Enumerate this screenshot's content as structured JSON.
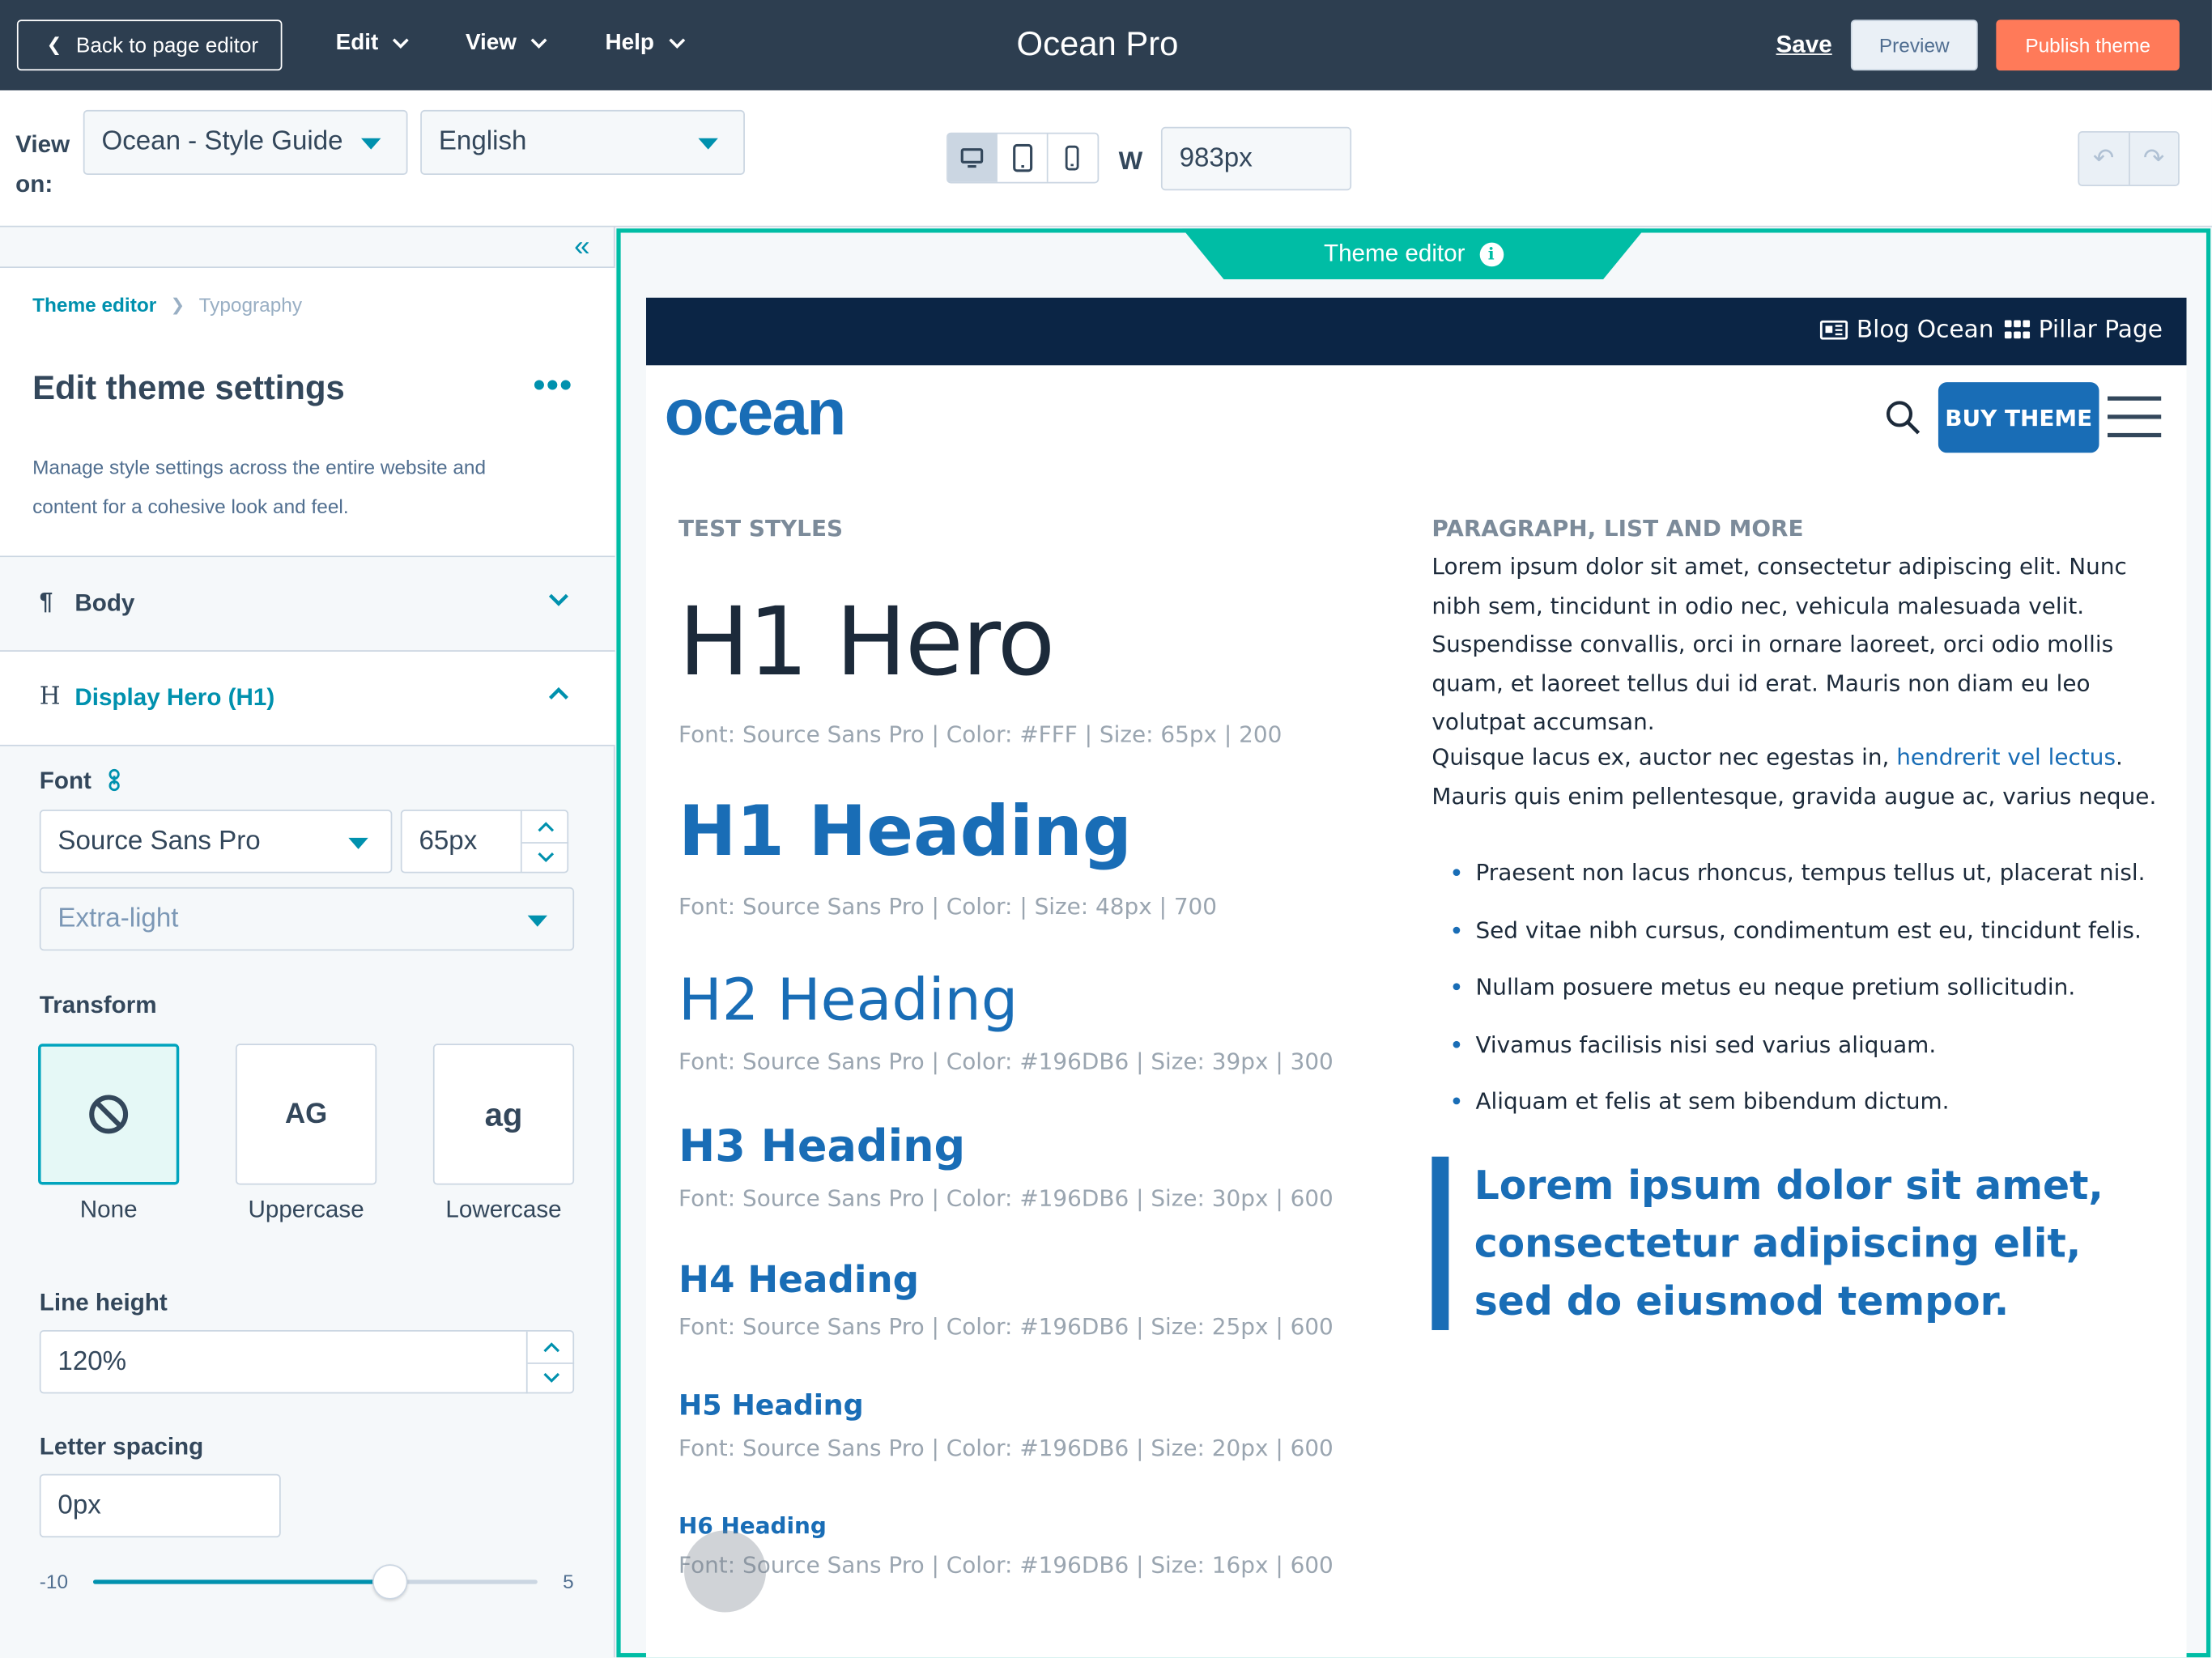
{
  "topbar": {
    "back_label": "Back to page editor",
    "menus": [
      "Edit",
      "View",
      "Help"
    ],
    "title": "Ocean Pro",
    "save_label": "Save",
    "preview_label": "Preview",
    "publish_label": "Publish theme"
  },
  "viewbar": {
    "view_on_label": "View on:",
    "page_select": "Ocean - Style Guide",
    "language_select": "English",
    "width_label": "W",
    "width_value": "983px",
    "active_device": "desktop"
  },
  "sidebar": {
    "breadcrumb": [
      "Theme editor",
      "Typography"
    ],
    "title": "Edit theme settings",
    "description": "Manage style settings across the entire website and content for a cohesive look and feel.",
    "sections": {
      "body": "Body",
      "display_hero": "Display Hero (H1)"
    },
    "font_label": "Font",
    "font_family": "Source Sans Pro",
    "font_size": "65px",
    "font_weight": "Extra-light",
    "transform_label": "Transform",
    "transform_options": [
      "None",
      "Uppercase",
      "Lowercase"
    ],
    "transform_glyphs": {
      "upper": "AG",
      "lower": "ag"
    },
    "transform_selected": "None",
    "line_height_label": "Line height",
    "line_height_value": "120%",
    "letter_spacing_label": "Letter spacing",
    "letter_spacing_value": "0px",
    "slider_min": "-10",
    "slider_max": "5",
    "slider_value": 0
  },
  "preview": {
    "frame_tab": "Theme editor",
    "top_links": [
      "Blog Ocean",
      "Pillar Page"
    ],
    "logo": "ocean",
    "buy_button": "BUY THEME",
    "left_heading": "TEST STYLES",
    "right_heading": "PARAGRAPH, LIST AND MORE",
    "headings": [
      {
        "text": "H1 Hero",
        "spec": "Font: Source Sans Pro | Color: #FFF | Size: 65px | 200"
      },
      {
        "text": "H1 Heading",
        "spec": "Font: Source Sans Pro | Color: | Size: 48px | 700"
      },
      {
        "text": "H2 Heading",
        "spec": "Font: Source Sans Pro | Color: #196DB6 | Size: 39px | 300"
      },
      {
        "text": "H3 Heading",
        "spec": "Font: Source Sans Pro | Color: #196DB6 | Size: 30px | 600"
      },
      {
        "text": "H4 Heading",
        "spec": "Font: Source Sans Pro | Color: #196DB6 | Size: 25px | 600"
      },
      {
        "text": "H5 Heading",
        "spec": "Font: Source Sans Pro | Color: #196DB6 | Size: 20px | 600"
      },
      {
        "text": "H6 Heading",
        "spec": "Font: Source Sans Pro | Color: #196DB6 | Size: 16px | 600"
      }
    ],
    "paragraph1": "Lorem ipsum dolor sit amet, consectetur adipiscing elit. Nunc nibh sem, tincidunt in odio nec, vehicula malesuada velit. Suspendisse convallis, orci in ornare laoreet, orci odio mollis quam, et laoreet tellus dui id erat. Mauris non diam eu leo volutpat accumsan.",
    "paragraph2_before": "Quisque lacus ex, auctor nec egestas in, ",
    "paragraph2_link": "hendrerit vel lectus",
    "paragraph2_after": ". Mauris quis enim pellentesque, gravida augue ac, varius neque.",
    "bullets": [
      "Praesent non lacus rhoncus, tempus tellus ut, placerat nisl.",
      "Sed vitae nibh cursus, condimentum est eu, tincidunt felis.",
      "Nullam posuere metus eu neque pretium sollicitudin.",
      "Vivamus facilisis nisi sed varius aliquam.",
      "Aliquam et felis at sem bibendum dictum."
    ],
    "blockquote": "Lorem ipsum dolor sit amet, consectetur adipiscing elit, sed do eiusmod tempor."
  },
  "colors": {
    "topbar_bg": "#2d3e50",
    "accent_teal": "#00bda5",
    "link_teal": "#0091ae",
    "publish_orange": "#ff7a59",
    "brand_blue": "#196db6",
    "site_navy": "#0b2545"
  }
}
